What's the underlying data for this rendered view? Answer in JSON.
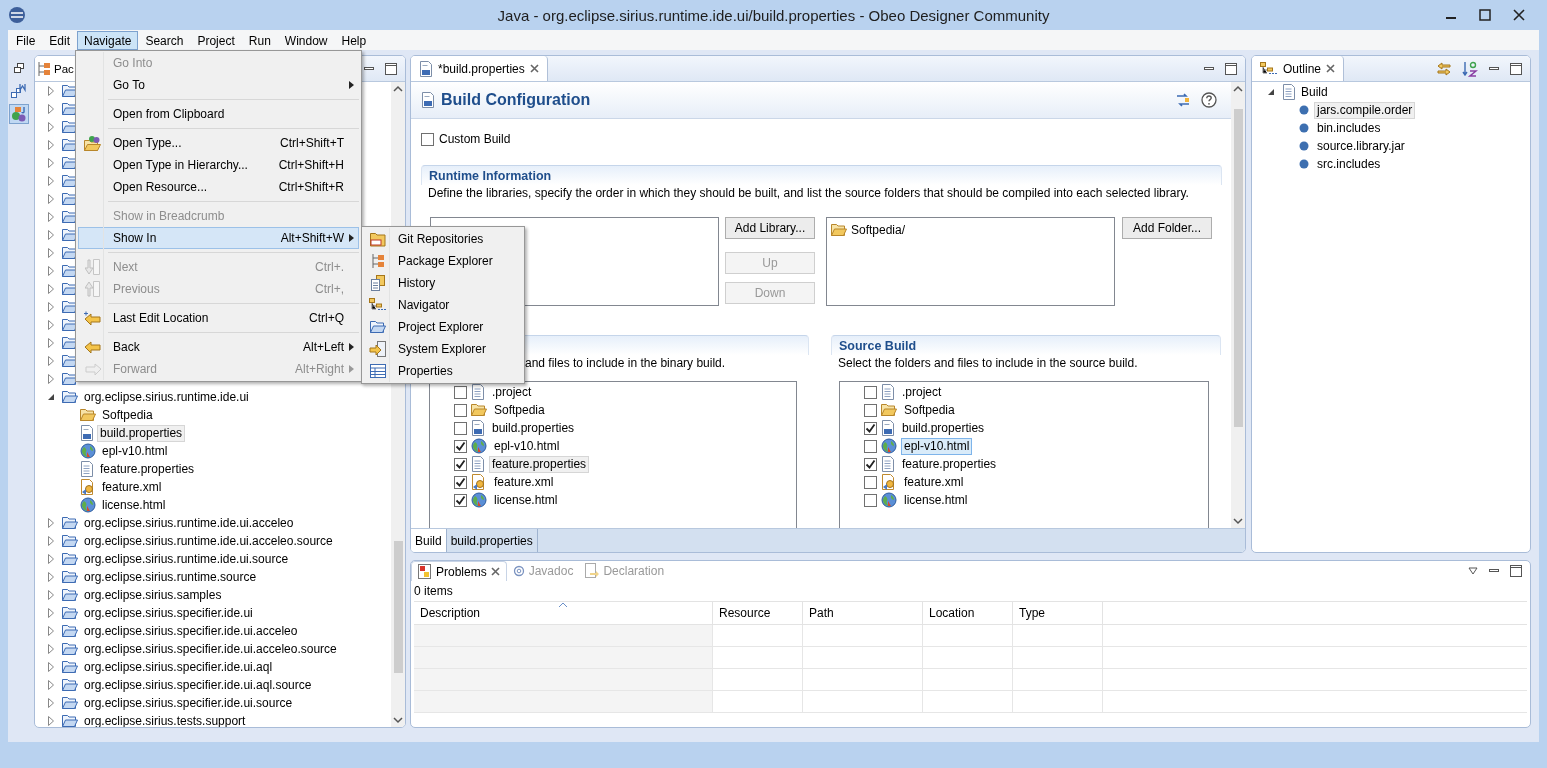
{
  "window": {
    "title": "Java - org.eclipse.sirius.runtime.ide.ui/build.properties - Obeo Designer Community"
  },
  "menu_bar": [
    {
      "label": "File",
      "selected": false
    },
    {
      "label": "Edit",
      "selected": false
    },
    {
      "label": "Navigate",
      "selected": true
    },
    {
      "label": "Search",
      "selected": false
    },
    {
      "label": "Project",
      "selected": false
    },
    {
      "label": "Run",
      "selected": false
    },
    {
      "label": "Window",
      "selected": false
    },
    {
      "label": "Help",
      "selected": false
    }
  ],
  "navigate_menu": {
    "groups": [
      [
        {
          "kind": "plain",
          "label": "Go Into",
          "disabled": true,
          "selected": false,
          "submenu": false
        },
        {
          "kind": "plain",
          "label": "Go To",
          "disabled": false,
          "selected": false,
          "submenu": true
        }
      ],
      [
        {
          "kind": "plain",
          "label": "Open from Clipboard",
          "disabled": false,
          "selected": false,
          "submenu": false
        }
      ],
      [
        {
          "kind": "type",
          "label": "Open Type...",
          "shortcut": "Ctrl+Shift+T",
          "disabled": false,
          "selected": false,
          "submenu": false
        },
        {
          "kind": "plain",
          "label": "Open Type in Hierarchy...",
          "shortcut": "Ctrl+Shift+H",
          "disabled": false,
          "selected": false,
          "submenu": false
        },
        {
          "kind": "plain",
          "label": "Open Resource...",
          "shortcut": "Ctrl+Shift+R",
          "disabled": false,
          "selected": false,
          "submenu": false
        }
      ],
      [
        {
          "kind": "plain",
          "label": "Show in Breadcrumb",
          "disabled": true,
          "selected": false,
          "submenu": false
        },
        {
          "kind": "plain",
          "label": "Show In",
          "shortcut": "Alt+Shift+W",
          "disabled": false,
          "selected": true,
          "submenu": true
        }
      ],
      [
        {
          "kind": "next",
          "label": "Next",
          "shortcut": "Ctrl+.",
          "disabled": true,
          "selected": false,
          "submenu": false
        },
        {
          "kind": "previous",
          "label": "Previous",
          "shortcut": "Ctrl+,",
          "disabled": true,
          "selected": false,
          "submenu": false
        }
      ],
      [
        {
          "kind": "edit",
          "label": "Last Edit Location",
          "shortcut": "Ctrl+Q",
          "disabled": false,
          "selected": false,
          "submenu": false
        }
      ],
      [
        {
          "kind": "back",
          "label": "Back",
          "shortcut": "Alt+Left",
          "disabled": false,
          "selected": false,
          "submenu": true
        },
        {
          "kind": "forward",
          "label": "Forward",
          "shortcut": "Alt+Right",
          "disabled": true,
          "selected": false,
          "submenu": true
        }
      ]
    ]
  },
  "show_in_submenu": [
    {
      "kind": "git",
      "label": "Git Repositories",
      "selected": false
    },
    {
      "kind": "packages",
      "label": "Package Explorer",
      "selected": false
    },
    {
      "kind": "history",
      "label": "History",
      "selected": false
    },
    {
      "kind": "navigator",
      "label": "Navigator",
      "selected": false
    },
    {
      "kind": "project",
      "label": "Project Explorer",
      "selected": false
    },
    {
      "kind": "system",
      "label": "System Explorer",
      "selected": false
    },
    {
      "kind": "properties",
      "label": "Properties",
      "selected": false
    }
  ],
  "trim_bar": [
    {
      "kind": "restore",
      "selected": false
    },
    {
      "kind": "modeling",
      "selected": false
    },
    {
      "kind": "java",
      "selected": true
    }
  ],
  "package_explorer": {
    "tab": "Pac",
    "items": [
      {
        "kind": "project",
        "expanded": false
      },
      {
        "kind": "project",
        "expanded": false
      },
      {
        "kind": "project",
        "expanded": false
      },
      {
        "kind": "project",
        "expanded": false
      },
      {
        "kind": "project",
        "expanded": false
      },
      {
        "kind": "project",
        "expanded": false
      },
      {
        "kind": "project",
        "expanded": false
      },
      {
        "kind": "project",
        "expanded": false
      },
      {
        "kind": "project",
        "expanded": false
      },
      {
        "kind": "project",
        "expanded": false
      },
      {
        "kind": "project",
        "expanded": false
      },
      {
        "kind": "project",
        "expanded": false
      },
      {
        "kind": "project",
        "expanded": false
      },
      {
        "kind": "project",
        "expanded": false
      },
      {
        "kind": "project",
        "expanded": false
      },
      {
        "kind": "project",
        "expanded": false
      },
      {
        "kind": "project",
        "expanded": false
      },
      {
        "kind": "project",
        "label": "org.eclipse.sirius.runtime.ide.ui",
        "expanded": true,
        "selected": false,
        "children": [
          {
            "kind": "folder",
            "label": "Softpedia",
            "selected": false
          },
          {
            "kind": "properties",
            "label": "build.properties",
            "selected": true
          },
          {
            "kind": "html",
            "label": "epl-v10.html",
            "selected": false
          },
          {
            "kind": "text",
            "label": "feature.properties",
            "selected": false
          },
          {
            "kind": "xml",
            "label": "feature.xml",
            "selected": false
          },
          {
            "kind": "html",
            "label": "license.html",
            "selected": false
          }
        ]
      },
      {
        "kind": "project",
        "label": "org.eclipse.sirius.runtime.ide.ui.acceleo",
        "expanded": false,
        "selected": false
      },
      {
        "kind": "project",
        "label": "org.eclipse.sirius.runtime.ide.ui.acceleo.source",
        "expanded": false,
        "selected": false
      },
      {
        "kind": "project",
        "label": "org.eclipse.sirius.runtime.ide.ui.source",
        "expanded": false,
        "selected": false
      },
      {
        "kind": "project",
        "label": "org.eclipse.sirius.runtime.source",
        "expanded": false,
        "selected": false
      },
      {
        "kind": "project",
        "label": "org.eclipse.sirius.samples",
        "expanded": false,
        "selected": false
      },
      {
        "kind": "project",
        "label": "org.eclipse.sirius.specifier.ide.ui",
        "expanded": false,
        "selected": false
      },
      {
        "kind": "project",
        "label": "org.eclipse.sirius.specifier.ide.ui.acceleo",
        "expanded": false,
        "selected": false
      },
      {
        "kind": "project",
        "label": "org.eclipse.sirius.specifier.ide.ui.acceleo.source",
        "expanded": false,
        "selected": false
      },
      {
        "kind": "project",
        "label": "org.eclipse.sirius.specifier.ide.ui.aql",
        "expanded": false,
        "selected": false
      },
      {
        "kind": "project",
        "label": "org.eclipse.sirius.specifier.ide.ui.aql.source",
        "expanded": false,
        "selected": false
      },
      {
        "kind": "project",
        "label": "org.eclipse.sirius.specifier.ide.ui.source",
        "expanded": false,
        "selected": false
      },
      {
        "kind": "project",
        "label": "org.eclipse.sirius.tests.support",
        "expanded": false,
        "selected": false
      }
    ]
  },
  "editor": {
    "tab": {
      "label": "*build.properties",
      "selected": true
    },
    "title": "Build Configuration",
    "custom_build": {
      "label": "Custom Build",
      "checked": false
    },
    "runtime": {
      "title": "Runtime Information",
      "description": "Define the libraries, specify the order in which they should be built, and list the source folders that should be compiled into each selected library.",
      "library_buttons": [
        {
          "label": "Add Library...",
          "disabled": false
        },
        {
          "label": "Up",
          "disabled": true
        },
        {
          "label": "Down",
          "disabled": true
        }
      ],
      "folders": [
        "Softpedia/"
      ],
      "folder_button": {
        "label": "Add Folder...",
        "disabled": false
      }
    },
    "binary_build": {
      "description": "and files to include in the binary build.",
      "items": [
        {
          "kind": "text",
          "label": ".project",
          "checked": false,
          "selected": false
        },
        {
          "kind": "folder",
          "label": "Softpedia",
          "checked": false,
          "selected": false
        },
        {
          "kind": "properties",
          "label": "build.properties",
          "checked": false,
          "selected": false
        },
        {
          "kind": "html",
          "label": "epl-v10.html",
          "checked": true,
          "selected": false
        },
        {
          "kind": "text",
          "label": "feature.properties",
          "checked": true,
          "selected": true
        },
        {
          "kind": "xml",
          "label": "feature.xml",
          "checked": true,
          "selected": false
        },
        {
          "kind": "html",
          "label": "license.html",
          "checked": true,
          "selected": false
        }
      ]
    },
    "source_build": {
      "title": "Source Build",
      "description": "Select the folders and files to include in the source build.",
      "items": [
        {
          "kind": "text",
          "label": ".project",
          "checked": false,
          "selected": false
        },
        {
          "kind": "folder",
          "label": "Softpedia",
          "checked": false,
          "selected": false
        },
        {
          "kind": "properties",
          "label": "build.properties",
          "checked": true,
          "selected": false
        },
        {
          "kind": "html",
          "label": "epl-v10.html",
          "checked": false,
          "selected": true
        },
        {
          "kind": "text",
          "label": "feature.properties",
          "checked": true,
          "selected": false
        },
        {
          "kind": "xml",
          "label": "feature.xml",
          "checked": false,
          "selected": false
        },
        {
          "kind": "html",
          "label": "license.html",
          "checked": false,
          "selected": false
        }
      ]
    },
    "bottom_tabs": [
      {
        "label": "Build",
        "selected": true
      },
      {
        "label": "build.properties",
        "selected": false
      }
    ]
  },
  "outline": {
    "tab": "Outline",
    "tree": {
      "label": "Build",
      "expanded": true,
      "children": [
        {
          "label": "jars.compile.order",
          "selected": true
        },
        {
          "label": "bin.includes",
          "selected": false
        },
        {
          "label": "source.library.jar",
          "selected": false
        },
        {
          "label": "src.includes",
          "selected": false
        }
      ]
    }
  },
  "problems": {
    "tabs": [
      {
        "kind": "problems",
        "label": "Problems",
        "selected": true
      },
      {
        "kind": "javadoc",
        "label": "Javadoc",
        "selected": false
      },
      {
        "kind": "declaration",
        "label": "Declaration",
        "selected": false
      }
    ],
    "summary": "0 items",
    "columns": [
      {
        "label": "Description",
        "sorted": true
      },
      {
        "label": "Resource",
        "sorted": false
      },
      {
        "label": "Path",
        "sorted": false
      },
      {
        "label": "Location",
        "sorted": false
      },
      {
        "label": "Type",
        "sorted": false
      }
    ]
  }
}
